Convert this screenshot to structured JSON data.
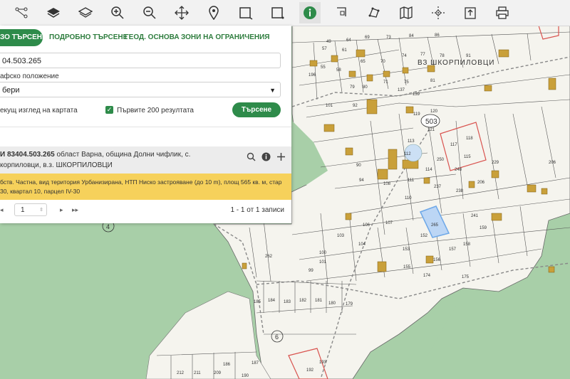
{
  "toolbar": {
    "items": [
      "tree-network",
      "layers",
      "layers-outline",
      "zoom-in",
      "zoom-out",
      "pan-move",
      "place-marker",
      "select-rectangle",
      "select-rectangle-dotted",
      "info",
      "zoom-area",
      "draw-polygon",
      "map",
      "measure-crosshair",
      "export",
      "print"
    ],
    "active": "info"
  },
  "tabs": [
    "ЗО ТЪРСЕНЕ",
    "ПОДРОБНО ТЪРСЕНЕ",
    "ГЕОД. ОСНОВА",
    "ЗОНИ НА ОГРАНИЧЕНИЯ"
  ],
  "search": {
    "value": "04.503.265",
    "location_label": "афско положение",
    "location_value": "бери",
    "current_view_label": "екущ изглед на картата",
    "first_200_label": "Първите 200 резултата",
    "search_button": "Търсене"
  },
  "result": {
    "line1_prefix": "И 83404.503.265",
    "line1_rest": " област Варна, община Долни чифлик, с.",
    "line2": "корпиловци, в.з. ШКОРПИЛОВЦИ",
    "detail_line1": "бств. Частна, вид територия Урбанизирана, НТП Ниско застрояване (до 10 m), площ 565 кв. м, стар",
    "detail_line2": "30, квартал 10, парцел IV-30"
  },
  "pager": {
    "page": "1",
    "summary": "1 - 1 от 1 записи"
  },
  "map": {
    "area_label": "ВЗ ШКОРПИЛОВЦИ",
    "block_label": "503",
    "circle_labels": [
      "4",
      "6"
    ],
    "parcel_numbers": [
      {
        "t": "196"
      },
      {
        "t": "49"
      },
      {
        "t": "64"
      },
      {
        "t": "69"
      },
      {
        "t": "73"
      },
      {
        "t": "84"
      },
      {
        "t": "86"
      },
      {
        "t": "57"
      },
      {
        "t": "61"
      },
      {
        "t": "65"
      },
      {
        "t": "70"
      },
      {
        "t": "74"
      },
      {
        "t": "77"
      },
      {
        "t": "78"
      },
      {
        "t": "91"
      },
      {
        "t": "55"
      },
      {
        "t": "58"
      },
      {
        "t": "71"
      },
      {
        "t": "75"
      },
      {
        "t": "81"
      },
      {
        "t": "137"
      },
      {
        "t": "139"
      },
      {
        "t": "79"
      },
      {
        "t": "80"
      },
      {
        "t": "101"
      },
      {
        "t": "92"
      },
      {
        "t": "112"
      },
      {
        "t": "114"
      },
      {
        "t": "113"
      },
      {
        "t": "118"
      },
      {
        "t": "117"
      },
      {
        "t": "115"
      },
      {
        "t": "120"
      },
      {
        "t": "119"
      },
      {
        "t": "121"
      },
      {
        "t": "229"
      },
      {
        "t": "250"
      },
      {
        "t": "248"
      },
      {
        "t": "206"
      },
      {
        "t": "90"
      },
      {
        "t": "94"
      },
      {
        "t": "108"
      },
      {
        "t": "110"
      },
      {
        "t": "111"
      },
      {
        "t": "237"
      },
      {
        "t": "238"
      },
      {
        "t": "241"
      },
      {
        "t": "265"
      },
      {
        "t": "152"
      },
      {
        "t": "107"
      },
      {
        "t": "106"
      },
      {
        "t": "103"
      },
      {
        "t": "104"
      },
      {
        "t": "156"
      },
      {
        "t": "157"
      },
      {
        "t": "158"
      },
      {
        "t": "159"
      },
      {
        "t": "153"
      },
      {
        "t": "155"
      },
      {
        "t": "101"
      },
      {
        "t": "100"
      },
      {
        "t": "99"
      },
      {
        "t": "262"
      },
      {
        "t": "175"
      },
      {
        "t": "174"
      },
      {
        "t": "179"
      },
      {
        "t": "180"
      },
      {
        "t": "181"
      },
      {
        "t": "182"
      },
      {
        "t": "183"
      },
      {
        "t": "184"
      },
      {
        "t": "185"
      },
      {
        "t": "193"
      },
      {
        "t": "192"
      },
      {
        "t": "212"
      },
      {
        "t": "211"
      },
      {
        "t": "209"
      },
      {
        "t": "187"
      },
      {
        "t": "186"
      },
      {
        "t": "190"
      },
      {
        "t": "206"
      }
    ]
  },
  "colors": {
    "accent": "#2e8b4a",
    "result_highlight": "#f6d15b",
    "forest": "#9dc9a1",
    "clearing": "#f4f4ee",
    "building": "#c9a03a",
    "selected_parcel": "#6ea8e8",
    "restricted_parcel": "#d9534f"
  }
}
